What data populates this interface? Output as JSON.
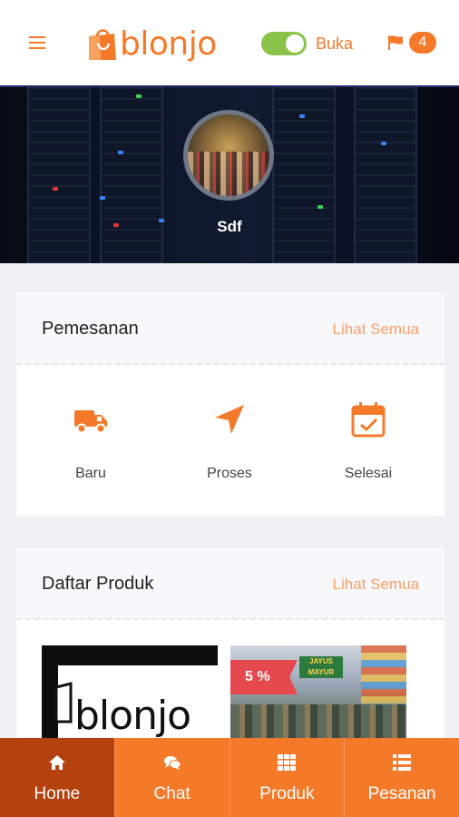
{
  "header": {
    "logo_text": "blonjo",
    "store_status": "Buka",
    "notification_count": "4",
    "brand_color": "#f47a2a",
    "toggle_color": "#8bc34a",
    "store_open": true
  },
  "banner": {
    "store_name": "Sdf"
  },
  "orders": {
    "title": "Pemesanan",
    "see_all": "Lihat Semua",
    "items": [
      {
        "label": "Baru",
        "icon": "truck-icon"
      },
      {
        "label": "Proses",
        "icon": "navigation-arrow-icon"
      },
      {
        "label": "Selesai",
        "icon": "calendar-check-icon"
      }
    ]
  },
  "products": {
    "title": "Daftar Produk",
    "see_all": "Lihat Semua",
    "items": [
      {
        "image_text": "blonjo"
      },
      {
        "discount": "5 %",
        "image_sign": "JAYUS MAYUR"
      }
    ]
  },
  "bottom_nav": {
    "active_color": "#b5410e",
    "items": [
      {
        "label": "Home",
        "icon": "home-icon",
        "active": true
      },
      {
        "label": "Chat",
        "icon": "chat-icon",
        "active": false
      },
      {
        "label": "Produk",
        "icon": "grid-icon",
        "active": false
      },
      {
        "label": "Pesanan",
        "icon": "list-icon",
        "active": false
      }
    ]
  }
}
